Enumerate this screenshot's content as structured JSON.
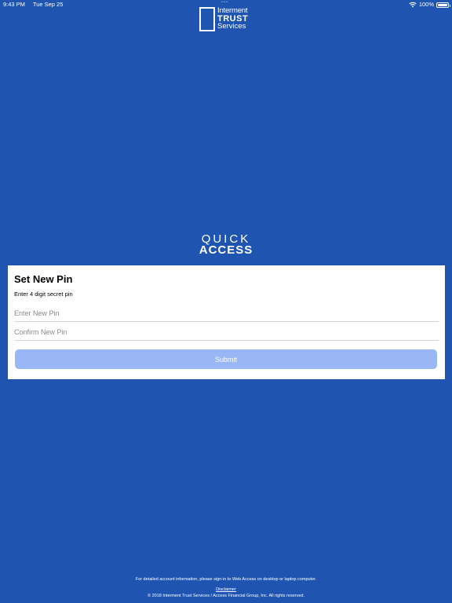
{
  "status_bar": {
    "time": "9:43 PM",
    "date": "Tue Sep 25",
    "center_hint": "• • •",
    "battery": "100%",
    "battery_level": 1.0
  },
  "logo": {
    "line1": "Interment",
    "line2": "TRUST",
    "line3": "Services"
  },
  "brand": {
    "quick": "QUICK",
    "access": "ACCESS"
  },
  "form": {
    "title": "Set New Pin",
    "subtitle": "Enter 4 digit secret pin",
    "new_pin": {
      "value": "",
      "placeholder": "Enter New Pin"
    },
    "confirm_pin": {
      "value": "",
      "placeholder": "Confirm New Pin"
    },
    "submit_label": "Submit"
  },
  "footer": {
    "info": "For detailed account information, please sign-in to Web Access on desktop or laptop computer.",
    "disclaimer": "Disclaimer",
    "copyright": "© 2018 Interment Trust Services / Access Financial Group, Inc. All rights reserved."
  },
  "colors": {
    "background": "#1f55b0",
    "submit_disabled": "#9ab7f5",
    "card": "#ffffff"
  },
  "icons": [
    "wifi-icon",
    "battery-icon",
    "logo-mark-icon"
  ]
}
